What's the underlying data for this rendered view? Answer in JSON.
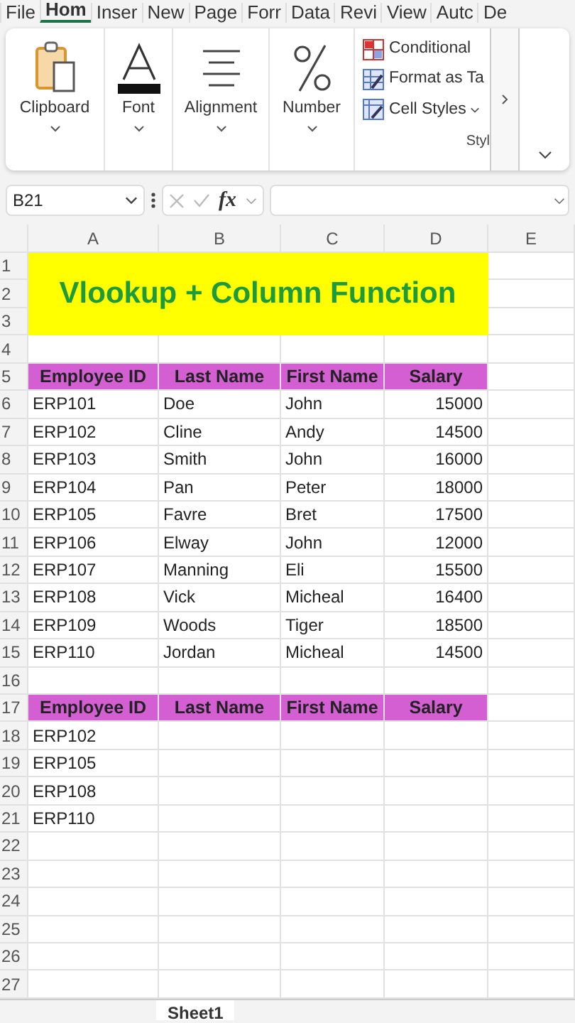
{
  "menu_tabs": [
    {
      "label": "File",
      "selected": false
    },
    {
      "label": "Hom",
      "selected": true
    },
    {
      "label": "Inser",
      "selected": false
    },
    {
      "label": "New",
      "selected": false
    },
    {
      "label": "Page",
      "selected": false
    },
    {
      "label": "Forr",
      "selected": false
    },
    {
      "label": "Data",
      "selected": false
    },
    {
      "label": "Revi",
      "selected": false
    },
    {
      "label": "View",
      "selected": false
    },
    {
      "label": "Autc",
      "selected": false
    },
    {
      "label": "De",
      "selected": false
    }
  ],
  "ribbon": {
    "groups": [
      {
        "kind": "clipboard",
        "label": "Clipboard"
      },
      {
        "kind": "font",
        "label": "Font"
      },
      {
        "kind": "alignment",
        "label": "Alignment"
      },
      {
        "kind": "number",
        "label": "Number"
      }
    ],
    "styles": {
      "items": [
        {
          "kind": "conditional",
          "label": "Conditional"
        },
        {
          "kind": "table",
          "label": "Format as Ta"
        },
        {
          "kind": "cellstyles",
          "label": "Cell Styles"
        }
      ],
      "label": "Styl"
    }
  },
  "formula_bar": {
    "name_box": "B21",
    "fx": "fx"
  },
  "sheet": {
    "columns": [
      "A",
      "B",
      "C",
      "D",
      "E"
    ],
    "row_numbers": [
      "1",
      "2",
      "3",
      "4",
      "5",
      "6",
      "7",
      "8",
      "9",
      "10",
      "11",
      "12",
      "13",
      "14",
      "15",
      "16",
      "17",
      "18",
      "19",
      "20",
      "21",
      "22",
      "23",
      "24",
      "25",
      "26",
      "27"
    ],
    "title": "Vlookup + Column Function",
    "tables": [
      {
        "header": [
          "Employee ID",
          "Last Name",
          "First Name",
          "Salary"
        ],
        "rows": [
          [
            "ERP101",
            "Doe",
            "John",
            "15000"
          ],
          [
            "ERP102",
            "Cline",
            "Andy",
            "14500"
          ],
          [
            "ERP103",
            "Smith",
            "John",
            "16000"
          ],
          [
            "ERP104",
            "Pan",
            "Peter",
            "18000"
          ],
          [
            "ERP105",
            "Favre",
            "Bret",
            "17500"
          ],
          [
            "ERP106",
            "Elway",
            "John",
            "12000"
          ],
          [
            "ERP107",
            "Manning",
            "Eli",
            "15500"
          ],
          [
            "ERP108",
            "Vick",
            "Micheal",
            "16400"
          ],
          [
            "ERP109",
            "Woods",
            "Tiger",
            "18500"
          ],
          [
            "ERP110",
            "Jordan",
            "Micheal",
            "14500"
          ]
        ]
      },
      {
        "header": [
          "Employee ID",
          "Last Name",
          "First Name",
          "Salary"
        ],
        "rows": [
          [
            "ERP102"
          ],
          [
            "ERP105"
          ],
          [
            "ERP108"
          ],
          [
            "ERP110"
          ]
        ]
      }
    ]
  },
  "sheet_tabs": [
    {
      "label": "Sheet1",
      "selected": true
    }
  ]
}
